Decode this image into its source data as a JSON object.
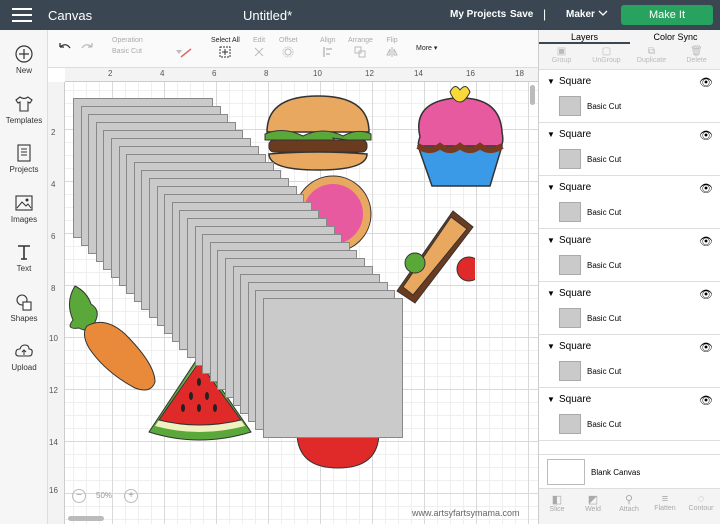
{
  "header": {
    "app_name": "Canvas",
    "doc_title": "Untitled*",
    "my_projects": "My Projects",
    "save": "Save",
    "separator": "|",
    "machine": "Maker",
    "make_it": "Make It"
  },
  "nav": [
    {
      "label": "New",
      "icon": "plus-circle-icon"
    },
    {
      "label": "Templates",
      "icon": "tshirt-icon"
    },
    {
      "label": "Projects",
      "icon": "notebook-icon"
    },
    {
      "label": "Images",
      "icon": "image-icon"
    },
    {
      "label": "Text",
      "icon": "text-icon"
    },
    {
      "label": "Shapes",
      "icon": "shapes-icon"
    },
    {
      "label": "Upload",
      "icon": "upload-icon"
    }
  ],
  "toolbar": {
    "operation_label": "Operation",
    "operation_value": "Basic Cut",
    "select_all": "Select All",
    "edit": "Edit",
    "offset": "Offset",
    "align": "Align",
    "arrange": "Arrange",
    "flip": "Flip",
    "more": "More"
  },
  "ruler": {
    "top": [
      "2",
      "4",
      "6",
      "8",
      "10",
      "12",
      "14",
      "16",
      "18"
    ],
    "left": [
      "2",
      "4",
      "6",
      "8",
      "10",
      "12",
      "14",
      "16"
    ]
  },
  "zoom": {
    "minus": "−",
    "value": "50%",
    "plus": "+"
  },
  "watermark": "www.artsyfartsymama.com",
  "panel": {
    "tab_layers": "Layers",
    "tab_color_sync": "Color Sync",
    "tools": [
      "Group",
      "UnGroup",
      "Duplicate",
      "Delete"
    ],
    "layers": [
      {
        "name": "Square",
        "op": "Basic Cut"
      },
      {
        "name": "Square",
        "op": "Basic Cut"
      },
      {
        "name": "Square",
        "op": "Basic Cut"
      },
      {
        "name": "Square",
        "op": "Basic Cut"
      },
      {
        "name": "Square",
        "op": "Basic Cut"
      },
      {
        "name": "Square",
        "op": "Basic Cut"
      },
      {
        "name": "Square",
        "op": "Basic Cut"
      }
    ],
    "blank_canvas": "Blank Canvas",
    "bottom_tools": [
      "Slice",
      "Weld",
      "Attach",
      "Flatten",
      "Contour"
    ]
  },
  "colors": {
    "topbar": "#3a4753",
    "make_it": "#27a35f",
    "square_fill": "#cacaca"
  }
}
